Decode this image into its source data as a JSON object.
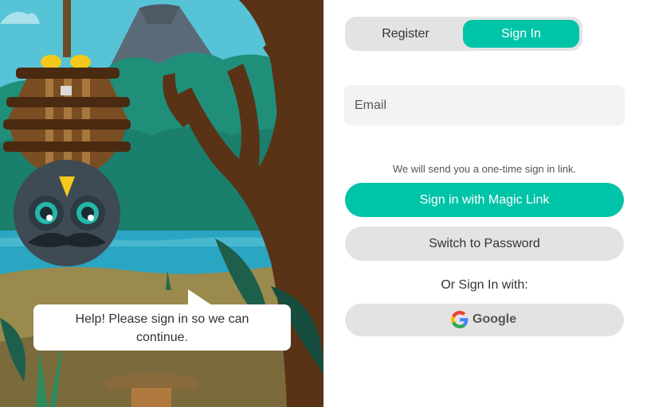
{
  "illustration": {
    "speech_line1": "Help! Please sign in so we can",
    "speech_line2": "continue."
  },
  "tabs": {
    "register_label": "Register",
    "signin_label": "Sign In",
    "active": "Sign In"
  },
  "form": {
    "email_placeholder": "Email",
    "email_value": "",
    "hint": "We will send you a one-time sign in link.",
    "magic_link_label": "Sign in with Magic Link",
    "switch_password_label": "Switch to Password",
    "or_label": "Or Sign In with:",
    "google_label": "Google"
  },
  "colors": {
    "accent": "#00c4a7",
    "button_gray": "#e3e3e3",
    "input_bg": "#f3f3f3"
  },
  "icons": [
    "google-icon"
  ]
}
